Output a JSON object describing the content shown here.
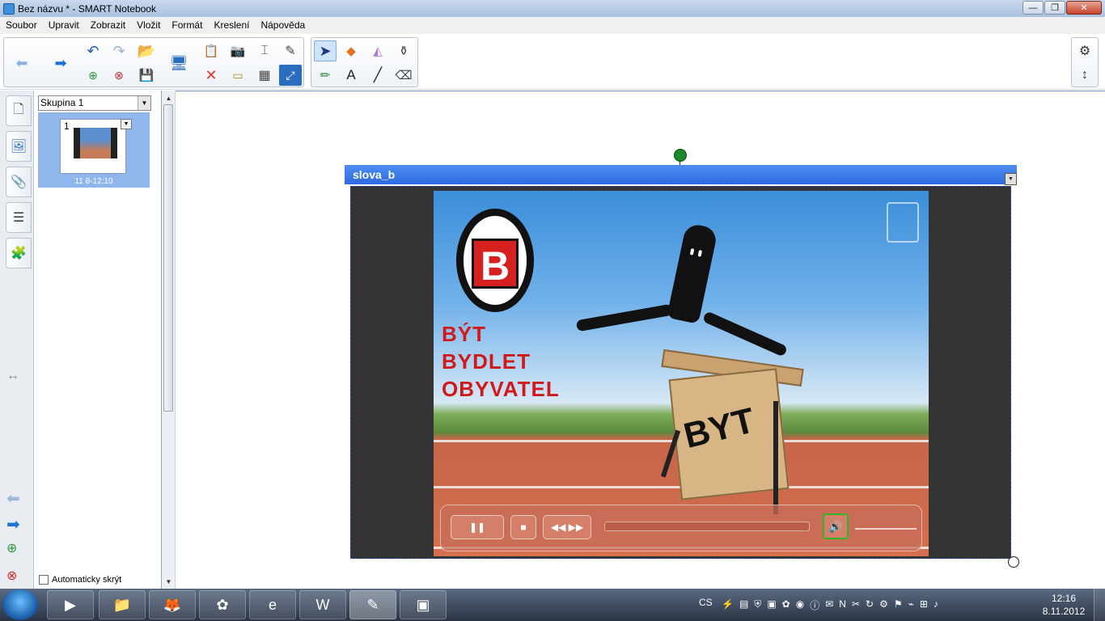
{
  "window": {
    "title": "Bez názvu * - SMART Notebook",
    "minimize": "—",
    "maximize": "❐",
    "close": "✕"
  },
  "menu": [
    "Soubor",
    "Upravit",
    "Zobrazit",
    "Vložit",
    "Formát",
    "Kreslení",
    "Nápověda"
  ],
  "sorter": {
    "group": "Skupina 1",
    "page_number": "1",
    "page_caption": "11 8-12:10",
    "autohide_label": "Automaticky skrýt"
  },
  "video": {
    "title": "slova_b",
    "letter": "B",
    "words": [
      "BÝT",
      "BYDLET",
      "OBYVATEL"
    ],
    "hurdle_text": "BYT"
  },
  "taskbar": {
    "language": "CS",
    "time": "12:16",
    "date": "8.11.2012"
  }
}
